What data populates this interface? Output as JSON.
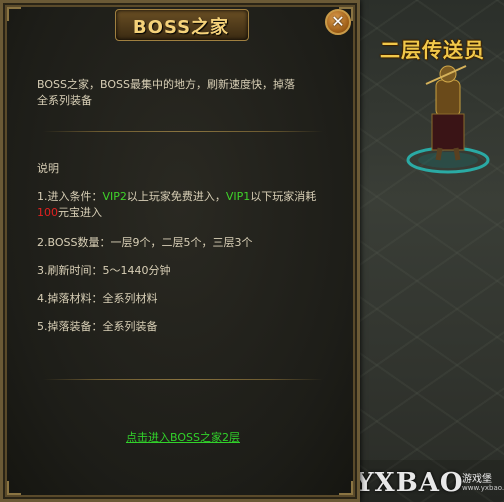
{
  "scene": {
    "npc_name": "二层传送员"
  },
  "dialog": {
    "title": "BOSS之家",
    "close_label": "✕",
    "intro": "BOSS之家，BOSS最集中的地方，刷新速度快，掉落全系列装备",
    "section_title": "说明",
    "items": [
      {
        "prefix": "1.进入条件：",
        "vip2": "VIP2",
        "part1": "以上玩家免费进入，",
        "vip1": "VIP1",
        "part2": "以下玩家消耗",
        "cost": "100",
        "part3": "元宝进入"
      },
      {
        "text": "2.BOSS数量：一层9个，二层5个，三层3个"
      },
      {
        "text": "3.刷新时间：5～1440分钟"
      },
      {
        "text": "4.掉落材料：全系列材料"
      },
      {
        "text": "5.掉落装备：全系列装备"
      }
    ],
    "enter_link": "点击进入BOSS之家2层"
  },
  "watermark": {
    "brand": "YXBAO",
    "sub": "游戏堡",
    "url": "www.yxbao.com"
  },
  "colors": {
    "highlight_green": "#3fd22a",
    "highlight_red": "#e02020",
    "title_gold": "#f5d27a"
  }
}
